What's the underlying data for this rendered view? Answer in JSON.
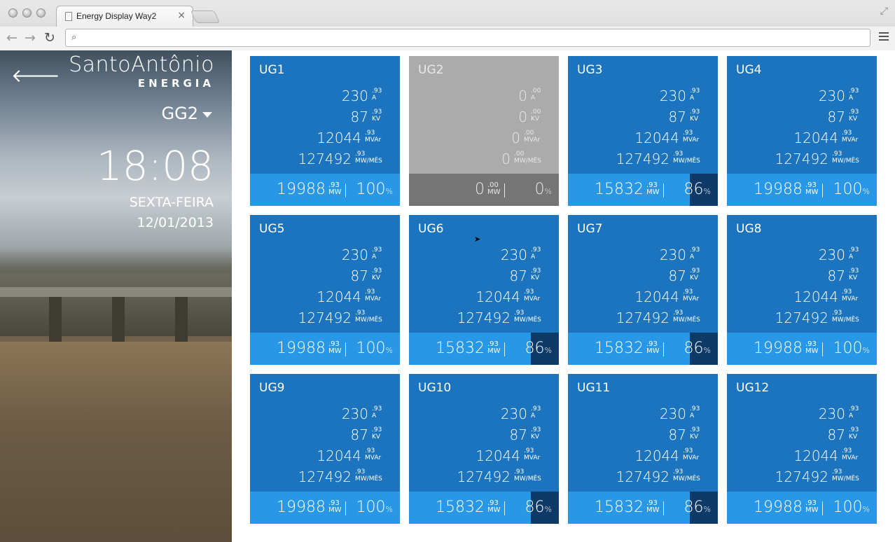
{
  "browser": {
    "tab_title": "Energy Display Way2",
    "tab_close": "×",
    "address": ""
  },
  "sidebar": {
    "brand_name": "SantoAntônio",
    "brand_sub": "ENERGIA",
    "group": "GG2",
    "time": "18:08",
    "weekday": "SEXTA-FEIRA",
    "date": "12/01/2013"
  },
  "units": {
    "current": "A",
    "voltage": "KV",
    "reactive": "MVAr",
    "energy": "MW/MÊS",
    "power": "MW",
    "percent": "%"
  },
  "colors": {
    "card_on": "#1b74bd",
    "bar_on": "#2897e6",
    "card_off": "#ababab",
    "bar_off": "#757575",
    "pct_dark": "#0d3a66"
  },
  "units_list": [
    {
      "name": "UG1",
      "status": "on",
      "a": "230",
      "a_dec": ".93",
      "kv": "87",
      "kv_dec": ".93",
      "mvar": "12044",
      "mvar_dec": ".93",
      "mwmes": "127492",
      "mwmes_dec": ".93",
      "mw": "19988",
      "mw_dec": ".93",
      "pct": "100",
      "pct_value": 100
    },
    {
      "name": "UG2",
      "status": "off",
      "a": "0",
      "a_dec": ".00",
      "kv": "0",
      "kv_dec": ".00",
      "mvar": "0",
      "mvar_dec": ".00",
      "mwmes": "0",
      "mwmes_dec": ".00",
      "mw": "0",
      "mw_dec": ".00",
      "pct": "0",
      "pct_value": 0
    },
    {
      "name": "UG3",
      "status": "on",
      "a": "230",
      "a_dec": ".93",
      "kv": "87",
      "kv_dec": ".93",
      "mvar": "12044",
      "mvar_dec": ".93",
      "mwmes": "127492",
      "mwmes_dec": ".93",
      "mw": "15832",
      "mw_dec": ".93",
      "pct": "86",
      "pct_value": 86
    },
    {
      "name": "UG4",
      "status": "on",
      "a": "230",
      "a_dec": ".93",
      "kv": "87",
      "kv_dec": ".93",
      "mvar": "12044",
      "mvar_dec": ".93",
      "mwmes": "127492",
      "mwmes_dec": ".93",
      "mw": "19988",
      "mw_dec": ".93",
      "pct": "100",
      "pct_value": 100
    },
    {
      "name": "UG5",
      "status": "on",
      "a": "230",
      "a_dec": ".93",
      "kv": "87",
      "kv_dec": ".93",
      "mvar": "12044",
      "mvar_dec": ".93",
      "mwmes": "127492",
      "mwmes_dec": ".93",
      "mw": "19988",
      "mw_dec": ".93",
      "pct": "100",
      "pct_value": 100
    },
    {
      "name": "UG6",
      "status": "on",
      "a": "230",
      "a_dec": ".93",
      "kv": "87",
      "kv_dec": ".93",
      "mvar": "12044",
      "mvar_dec": ".93",
      "mwmes": "127492",
      "mwmes_dec": ".93",
      "mw": "15832",
      "mw_dec": ".93",
      "pct": "86",
      "pct_value": 86
    },
    {
      "name": "UG7",
      "status": "on",
      "a": "230",
      "a_dec": ".93",
      "kv": "87",
      "kv_dec": ".93",
      "mvar": "12044",
      "mvar_dec": ".93",
      "mwmes": "127492",
      "mwmes_dec": ".93",
      "mw": "15832",
      "mw_dec": ".93",
      "pct": "86",
      "pct_value": 86
    },
    {
      "name": "UG8",
      "status": "on",
      "a": "230",
      "a_dec": ".93",
      "kv": "87",
      "kv_dec": ".93",
      "mvar": "12044",
      "mvar_dec": ".93",
      "mwmes": "127492",
      "mwmes_dec": ".93",
      "mw": "19988",
      "mw_dec": ".93",
      "pct": "100",
      "pct_value": 100
    },
    {
      "name": "UG9",
      "status": "on",
      "a": "230",
      "a_dec": ".93",
      "kv": "87",
      "kv_dec": ".93",
      "mvar": "12044",
      "mvar_dec": ".93",
      "mwmes": "127492",
      "mwmes_dec": ".93",
      "mw": "19988",
      "mw_dec": ".93",
      "pct": "100",
      "pct_value": 100
    },
    {
      "name": "UG10",
      "status": "on",
      "a": "230",
      "a_dec": ".93",
      "kv": "87",
      "kv_dec": ".93",
      "mvar": "12044",
      "mvar_dec": ".93",
      "mwmes": "127492",
      "mwmes_dec": ".93",
      "mw": "15832",
      "mw_dec": ".93",
      "pct": "86",
      "pct_value": 86
    },
    {
      "name": "UG11",
      "status": "on",
      "a": "230",
      "a_dec": ".93",
      "kv": "87",
      "kv_dec": ".93",
      "mvar": "12044",
      "mvar_dec": ".93",
      "mwmes": "127492",
      "mwmes_dec": ".93",
      "mw": "15832",
      "mw_dec": ".93",
      "pct": "86",
      "pct_value": 86
    },
    {
      "name": "UG12",
      "status": "on",
      "a": "230",
      "a_dec": ".93",
      "kv": "87",
      "kv_dec": ".93",
      "mvar": "12044",
      "mvar_dec": ".93",
      "mwmes": "127492",
      "mwmes_dec": ".93",
      "mw": "19988",
      "mw_dec": ".93",
      "pct": "100",
      "pct_value": 100
    }
  ]
}
